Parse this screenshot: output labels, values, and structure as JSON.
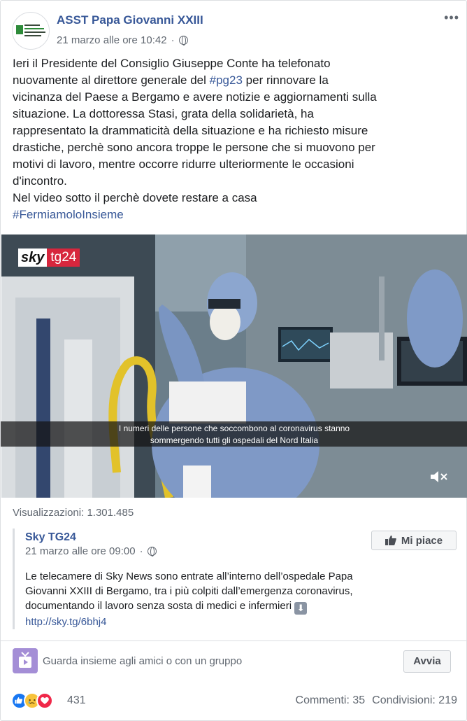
{
  "post": {
    "page_name": "ASST Papa Giovanni XXIII",
    "date": "21 marzo alle ore 10:42",
    "more_label": "•••",
    "text_lines": [
      "Ieri il Presidente del Consiglio Giuseppe Conte ha telefonato",
      "nuovamente al direttore generale del",
      "vicinanza del Paese a Bergamo e avere notizie e aggiornamenti sulla",
      "situazione. La dottoressa Stasi, grata della solidarietà, ha",
      "rappresentato la drammaticità della situazione e ha richiesto misure",
      "drastiche, perchè sono ancora troppe le persone che si muovono per",
      "motivi di lavoro, mentre occorre ridurre ulteriormente le occasioni",
      "d'incontro.",
      "Nel video sotto il perchè dovete restare a casa"
    ],
    "inline_hashtag": "#pg23",
    "line2_suffix": "per rinnovare la",
    "closing_hashtag": "#FermiamoloInsieme"
  },
  "video": {
    "channel_logo_sky": "sky",
    "channel_logo_tg": "tg24",
    "subtitle_line1": "I numeri delle persone che soccombono al coronavirus stanno",
    "subtitle_line2": "sommergendo tutti gli ospedali del Nord Italia",
    "mute_icon": "speaker-muted-icon"
  },
  "views": "Visualizzazioni: 1.301.485",
  "shared": {
    "source_name": "Sky TG24",
    "date": "21 marzo alle ore 09:00",
    "like_button": "Mi piace",
    "text_lines": [
      "Le telecamere di Sky News sono entrate all’interno dell’ospedale Papa",
      "Giovanni XXIII di Bergamo, tra i più colpiti dall’emergenza coronavirus,",
      "documentando il lavoro senza sosta di medici e infermieri"
    ],
    "arrow_emoji": "⬇",
    "link": "http://sky.tg/6bhj4"
  },
  "watch_party": {
    "text": "Guarda insieme agli amici o con un gruppo",
    "button": "Avvia"
  },
  "footer": {
    "reaction_count": "431",
    "comments": "Commenti: 35",
    "shares": "Condivisioni: 219"
  },
  "colors": {
    "link_blue": "#385898",
    "muted_text": "#606770",
    "like_blue": "#1877f2",
    "love_red": "#f02849",
    "sad_yellow": "#f7c33c",
    "sky_red": "#d7263d"
  }
}
